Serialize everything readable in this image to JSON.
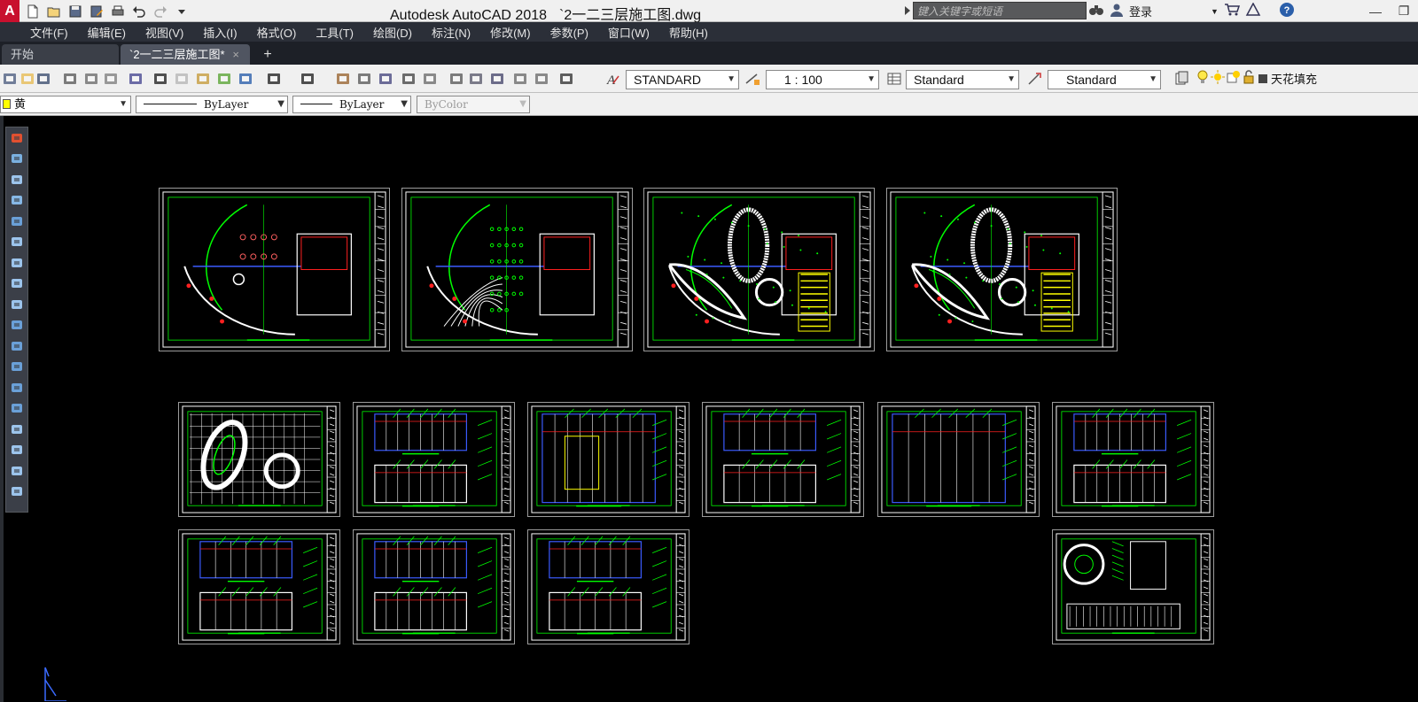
{
  "app": {
    "logo": "A",
    "title": "Autodesk AutoCAD 2018",
    "filename": "`2一二三层施工图.dwg"
  },
  "search": {
    "placeholder": "键入关键字或短语"
  },
  "account": {
    "login_label": "登录"
  },
  "menu": [
    "文件(F)",
    "编辑(E)",
    "视图(V)",
    "插入(I)",
    "格式(O)",
    "工具(T)",
    "绘图(D)",
    "标注(N)",
    "修改(M)",
    "参数(P)",
    "窗口(W)",
    "帮助(H)"
  ],
  "tabs": [
    {
      "label": "开始"
    },
    {
      "label": "`2一二三层施工图*",
      "close": "×"
    }
  ],
  "tab_add": "+",
  "styles": {
    "text_style": "STANDARD",
    "dim_scale": "1 : 100",
    "dim_style": "Standard",
    "table_style": "Standard"
  },
  "layer": {
    "current": "天花填充",
    "color_name": "黄",
    "color_hex": "#ffff00"
  },
  "properties": {
    "linetype": "ByLayer",
    "lineweight": "ByLayer",
    "plotstyle": "ByColor"
  },
  "colors": {
    "canvas": "#000000",
    "linework_green": "#00ff00",
    "accent_red": "#ff2020",
    "accent_blue": "#3b5bff",
    "accent_yellow": "#ffff00"
  },
  "icons": {
    "qat": [
      "new-icon",
      "open-icon",
      "save-icon",
      "save-as-icon",
      "plot-icon",
      "undo-icon",
      "redo-icon",
      "customize-icon"
    ],
    "toolbar": [
      "new-icon",
      "open-icon",
      "save-icon",
      "plot-icon",
      "plot-preview-icon",
      "publish-icon",
      "3d-print-icon",
      "cut-icon",
      "copy-icon",
      "paste-icon",
      "match-properties-icon",
      "block-editor-icon",
      "undo-icon",
      "redo-icon",
      "pan-icon",
      "zoom-realtime-icon",
      "zoom-window-icon",
      "zoom-previous-icon",
      "properties-icon",
      "design-center-icon",
      "tool-palettes-icon",
      "sheet-set-icon",
      "markup-icon",
      "calculator-icon",
      "help-icon"
    ],
    "draw_tools": [
      "erase-icon",
      "copy-object-icon",
      "mirror-icon",
      "offset-icon",
      "array-icon",
      "move-icon",
      "rotate-icon",
      "scale-icon",
      "stretch-icon",
      "trim-icon",
      "extend-icon",
      "break-at-point-icon",
      "break-icon",
      "join-icon",
      "chamfer-icon",
      "fillet-icon",
      "blend-icon",
      "explode-icon"
    ]
  }
}
